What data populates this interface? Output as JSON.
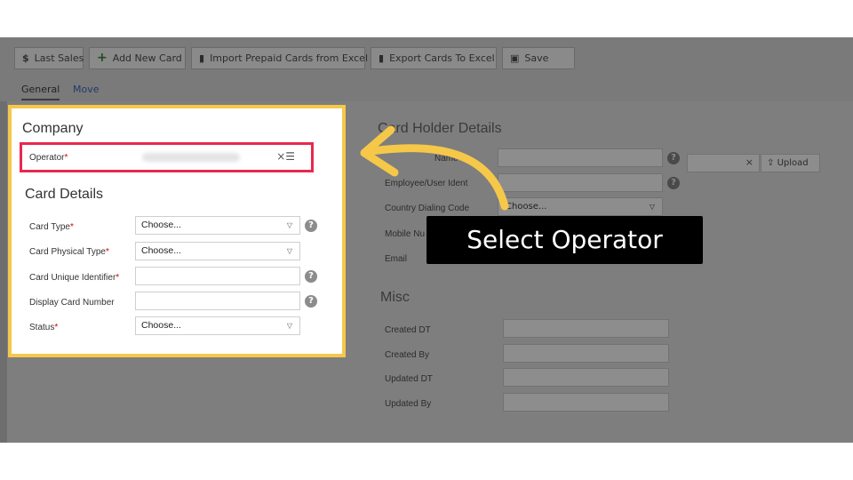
{
  "toolbar": {
    "last_sales": "Last Sales",
    "last_sales_icon": "$",
    "add_new_card": "Add New Card",
    "import_excel": "Import Prepaid Cards from Excel",
    "export_excel": "Export Cards To Excel",
    "save": "Save"
  },
  "tabs": {
    "general": "General",
    "move": "Move"
  },
  "company": {
    "heading": "Company",
    "operator_label": "Operator",
    "operator_icons": "×☰"
  },
  "card_details": {
    "heading": "Card Details",
    "card_type_label": "Card Type",
    "card_type_value": "Choose...",
    "physical_type_label": "Card Physical Type",
    "physical_type_value": "Choose...",
    "unique_id_label": "Card Unique Identifier",
    "display_number_label": "Display Card Number",
    "status_label": "Status",
    "status_value": "Choose..."
  },
  "card_holder": {
    "heading": "Card Holder Details",
    "name_label": "Name",
    "employee_label": "Employee/User Ident",
    "country_code_label": "Country Dialing Code",
    "country_code_value": "Choose...",
    "mobile_label": "Mobile Nu",
    "email_label": "Email",
    "upload_label": "Upload"
  },
  "misc": {
    "heading": "Misc",
    "created_dt": "Created DT",
    "created_by": "Created By",
    "updated_dt": "Updated DT",
    "updated_by": "Updated By"
  },
  "callout": {
    "text": "Select Operator"
  },
  "colors": {
    "highlight_border": "#f5c84a",
    "operator_border": "#e8294d",
    "arrow": "#f5c84a"
  }
}
